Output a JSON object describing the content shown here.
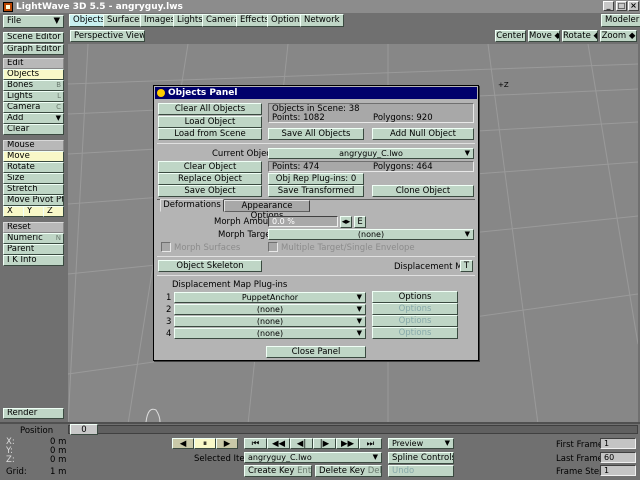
{
  "app": {
    "title": "LightWave 3D 5.5 - angryguy.lws",
    "modeler": "Modeler"
  },
  "file_menu": "File",
  "tabs": [
    "Objects",
    "Surfaces",
    "Images",
    "Lights",
    "Camera",
    "Effects",
    "Options",
    "Network"
  ],
  "sidebar": {
    "scene_editor": "Scene Editor",
    "graph_editor": "Graph Editor",
    "edit": "Edit",
    "objects": "Objects",
    "bones": "Bones",
    "lights": "Lights",
    "camera": "Camera",
    "add": "Add",
    "clear": "Clear",
    "mouse": "Mouse",
    "move": "Move",
    "rotate": "Rotate",
    "size": "Size",
    "stretch": "Stretch",
    "move_pivot": "Move Pivot Pt",
    "x": "X",
    "y": "Y",
    "z": "Z",
    "reset": "Reset",
    "numeric": "Numeric",
    "parent": "Parent",
    "ik_info": "I K Info",
    "render": "Render",
    "keys": {
      "bones": "B",
      "lights": "L",
      "camera": "C",
      "add": "+",
      "numeric": "N"
    }
  },
  "viewport": {
    "view": "Perspective View",
    "center": "Center",
    "move": "Move",
    "rotate": "Rotate",
    "zoom": "Zoom",
    "axis_z": "+Z"
  },
  "panel": {
    "title": "Objects Panel",
    "clear_all": "Clear All Objects",
    "load_object": "Load Object",
    "load_from_scene": "Load from Scene",
    "save_all": "Save All Objects",
    "add_null": "Add Null Object",
    "objects_in_scene": "Objects in Scene: 38",
    "scene_points": "Points: 1082",
    "scene_polygons": "Polygons: 920",
    "current_object_label": "Current Object",
    "current_object": "angryguy_C.lwo",
    "clear_object": "Clear Object",
    "obj_points": "Points: 474",
    "obj_polygons": "Polygons: 464",
    "replace_object": "Replace Object",
    "obj_rep_plugins": "Obj Rep Plug-ins: 0",
    "save_object": "Save Object",
    "save_transformed": "Save Transformed",
    "clone_object": "Clone Object",
    "tab_deformations": "Deformations",
    "tab_appearance": "Appearance Options",
    "morph_amount_label": "Morph Amount",
    "morph_amount": "0.0 %",
    "env_btn": "E",
    "morph_target_label": "Morph Target",
    "morph_target": "(none)",
    "morph_surfaces": "Morph Surfaces",
    "multiple_target": "Multiple Target/Single Envelope",
    "object_skeleton": "Object Skeleton",
    "displacement_map": "Displacement Map",
    "disp_t": "T",
    "plugins_label": "Displacement Map Plug-ins",
    "plugins": [
      {
        "num": "1",
        "name": "PuppetAnchor",
        "options": "Options"
      },
      {
        "num": "2",
        "name": "(none)",
        "options": "Options"
      },
      {
        "num": "3",
        "name": "(none)",
        "options": "Options"
      },
      {
        "num": "4",
        "name": "(none)",
        "options": "Options"
      }
    ],
    "close": "Close Panel"
  },
  "bottom": {
    "position": "Position",
    "x_label": "X:",
    "y_label": "Y:",
    "z_label": "Z:",
    "x_val": "0 m",
    "y_val": "0 m",
    "z_val": "0 m",
    "grid_label": "Grid:",
    "grid_val": "1 m",
    "frame": "0",
    "selected_item_label": "Selected Item",
    "selected_item": "angryguy_C.lwo",
    "create_key": "Create Key",
    "create_key_hint": "Enter",
    "delete_key": "Delete Key",
    "delete_key_hint": "Del",
    "preview": "Preview",
    "spline_controls": "Spline Controls",
    "undo": "Undo",
    "first_frame_label": "First Frame",
    "first_frame": "1",
    "last_frame_label": "Last Frame",
    "last_frame": "60",
    "frame_step_label": "Frame Step",
    "frame_step": "1",
    "transport": [
      "◀",
      "⏸",
      "▶",
      "⏮",
      "◀◀",
      "◀|",
      "|▶",
      "▶▶",
      "⏭"
    ]
  }
}
